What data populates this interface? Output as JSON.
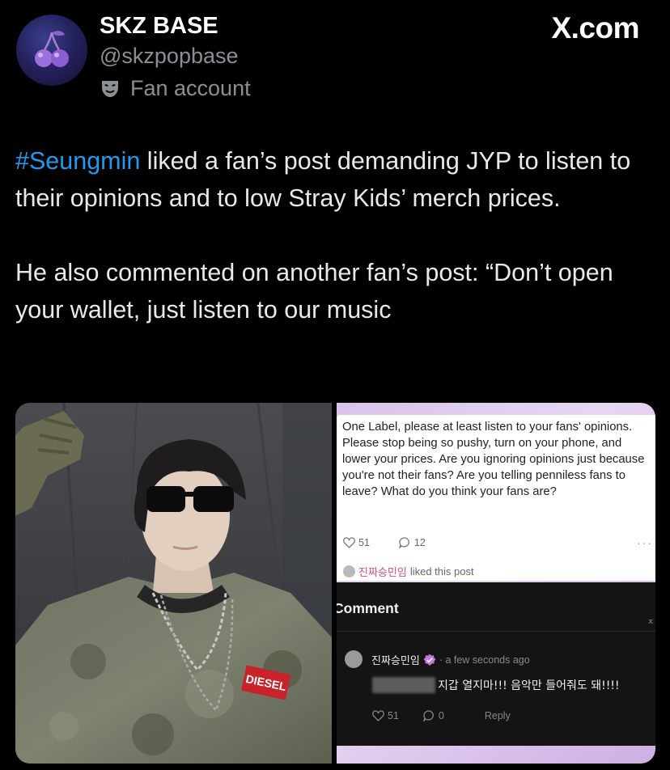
{
  "header": {
    "name": "SKZ BASE",
    "handle": "@skzpopbase",
    "badge": "Fan account",
    "badge_icon": "mask-icon",
    "avatar_icon": "cherry-icon",
    "brand": "X.com"
  },
  "tweet": {
    "hashtag": "#Seungmin",
    "line1_rest": " liked a fan’s post demanding JYP to listen to their opinions and to low Stray Kids’ merch prices.",
    "line2": "He also commented on another fan’s post: “Don’t open your wallet, just listen to our music"
  },
  "screenshot": {
    "post_text": "One Label, please at least listen to your fans' opinions. Please stop being so pushy, turn on your phone, and lower your prices. Are you ignoring opinions just because you're not their fans? Are you telling penniless fans to leave? What do you think your fans are?",
    "likes": "51",
    "comments": "12",
    "liked_by_name": "진짜승민임",
    "liked_by_text": "liked this post",
    "comment_header": "Comment",
    "commenter": "진짜승민임",
    "comment_time": "· a few seconds ago",
    "comment_text": "지갑 열지마!!! 음악만 들어줘도 돼!!!!",
    "comment_likes": "51",
    "comment_replies": "0",
    "reply_label": "Reply"
  },
  "photo": {
    "shirt_text": "DIESEL"
  },
  "colors": {
    "accent": "#1d9bf0",
    "background": "#000000",
    "pink_name": "#d2527a"
  }
}
